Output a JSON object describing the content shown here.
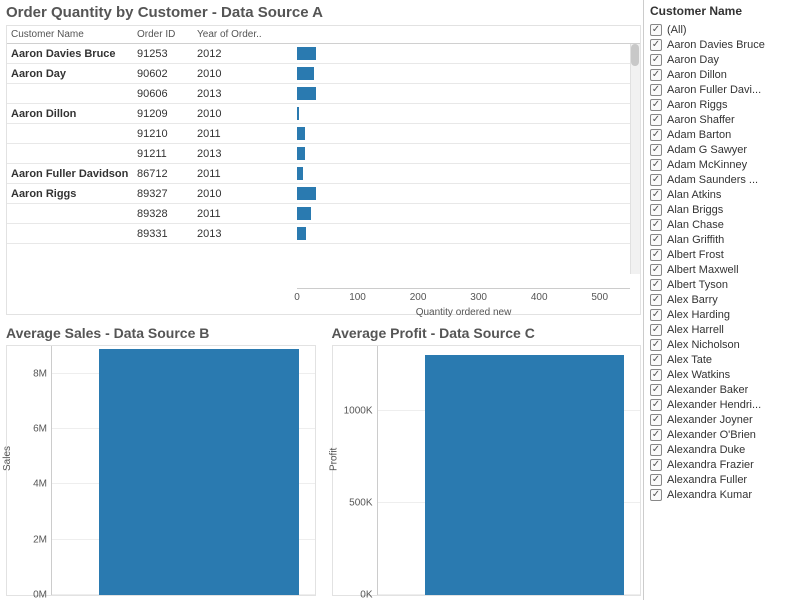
{
  "chart_data": [
    {
      "type": "bar",
      "title": "Order Quantity by Customer - Data Source A",
      "xlabel": "Quantity ordered new",
      "xlim": [
        0,
        550
      ],
      "xticks": [
        0,
        100,
        200,
        300,
        400,
        500
      ],
      "columns": [
        "Customer Name",
        "Order ID",
        "Year of Order.."
      ],
      "rows": [
        {
          "customer": "Aaron Davies Bruce",
          "order_id": "91253",
          "year": "2012",
          "value": 30,
          "show_name": true
        },
        {
          "customer": "Aaron Day",
          "order_id": "90602",
          "year": "2010",
          "value": 28,
          "show_name": true
        },
        {
          "customer": "Aaron Day",
          "order_id": "90606",
          "year": "2013",
          "value": 30,
          "show_name": false
        },
        {
          "customer": "Aaron Dillon",
          "order_id": "91209",
          "year": "2010",
          "value": 4,
          "show_name": true
        },
        {
          "customer": "Aaron Dillon",
          "order_id": "91210",
          "year": "2011",
          "value": 13,
          "show_name": false
        },
        {
          "customer": "Aaron Dillon",
          "order_id": "91211",
          "year": "2013",
          "value": 13,
          "show_name": false
        },
        {
          "customer": "Aaron Fuller Davidson",
          "order_id": "86712",
          "year": "2011",
          "value": 10,
          "show_name": true
        },
        {
          "customer": "Aaron Riggs",
          "order_id": "89327",
          "year": "2010",
          "value": 30,
          "show_name": true
        },
        {
          "customer": "Aaron Riggs",
          "order_id": "89328",
          "year": "2011",
          "value": 22,
          "show_name": false
        },
        {
          "customer": "Aaron Riggs",
          "order_id": "89331",
          "year": "2013",
          "value": 15,
          "show_name": false
        }
      ]
    },
    {
      "type": "bar",
      "title": "Average Sales - Data Source B",
      "ylabel": "Sales",
      "ylim": [
        0,
        9000000
      ],
      "yticks": [
        {
          "v": 0,
          "l": "0M"
        },
        {
          "v": 2000000,
          "l": "2M"
        },
        {
          "v": 4000000,
          "l": "4M"
        },
        {
          "v": 6000000,
          "l": "6M"
        },
        {
          "v": 8000000,
          "l": "8M"
        }
      ],
      "values": [
        8900000
      ]
    },
    {
      "type": "bar",
      "title": "Average Profit - Data Source C",
      "ylabel": "Profit",
      "ylim": [
        0,
        1350000
      ],
      "yticks": [
        {
          "v": 0,
          "l": "0K"
        },
        {
          "v": 500000,
          "l": "500K"
        },
        {
          "v": 1000000,
          "l": "1000K"
        }
      ],
      "values": [
        1300000
      ]
    }
  ],
  "filter": {
    "title": "Customer Name",
    "items": [
      "(All)",
      "Aaron Davies Bruce",
      "Aaron Day",
      "Aaron Dillon",
      "Aaron Fuller Davi...",
      "Aaron Riggs",
      "Aaron Shaffer",
      "Adam Barton",
      "Adam G Sawyer",
      "Adam McKinney",
      "Adam Saunders ...",
      "Alan Atkins",
      "Alan Briggs",
      "Alan Chase",
      "Alan Griffith",
      "Albert Frost",
      "Albert Maxwell",
      "Albert Tyson",
      "Alex Barry",
      "Alex Harding",
      "Alex Harrell",
      "Alex Nicholson",
      "Alex Tate",
      "Alex Watkins",
      "Alexander Baker",
      "Alexander Hendri...",
      "Alexander Joyner",
      "Alexander O'Brien",
      "Alexandra Duke",
      "Alexandra Frazier",
      "Alexandra Fuller",
      "Alexandra Kumar"
    ]
  }
}
